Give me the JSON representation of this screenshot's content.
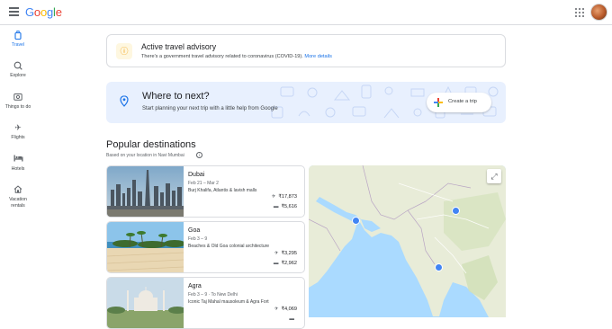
{
  "header": {
    "logo": [
      "G",
      "o",
      "o",
      "g",
      "l",
      "e"
    ],
    "menu_icon": "hamburger-menu-icon",
    "apps_icon": "apps-grid-icon"
  },
  "nav": [
    {
      "label": "Travel",
      "icon": "suitcase-icon",
      "active": true
    },
    {
      "label": "Explore",
      "icon": "explore-icon",
      "active": false
    },
    {
      "label": "Things to do",
      "icon": "camera-icon",
      "active": false
    },
    {
      "label": "Flights",
      "icon": "flight-icon",
      "active": false
    },
    {
      "label": "Hotels",
      "icon": "hotel-icon",
      "active": false
    },
    {
      "label": "Vacation rentals",
      "icon": "house-icon",
      "active": false
    }
  ],
  "advisory": {
    "title": "Active travel advisory",
    "text": "There's a government travel advisory related to coronavirus (COVID-19).",
    "link": "More details"
  },
  "where": {
    "title": "Where to next?",
    "subtitle": "Start planning your next trip with a little help from Google",
    "button": "Create a trip"
  },
  "popular": {
    "title": "Popular destinations",
    "subtitle": "Based on your location in Navi Mumbai",
    "destinations": [
      {
        "name": "Dubai",
        "dates": "Feb 21 – Mar 2",
        "desc": "Burj Khalifa, Atlantis & lavish malls",
        "flight_price": "₹17,873",
        "hotel_price": "₹5,616"
      },
      {
        "name": "Goa",
        "dates": "Feb 3 – 9",
        "desc": "Beaches & Old Goa colonial architecture",
        "flight_price": "₹3,295",
        "hotel_price": "₹2,962"
      },
      {
        "name": "Agra",
        "dates": "Feb 3 – 9 · To New Delhi",
        "desc": "Iconic Taj Mahal mausoleum & Agra Fort",
        "flight_price": "₹4,069",
        "hotel_price": ""
      }
    ]
  },
  "colors": {
    "accent": "#1a73e8",
    "advisory_bg": "#fef7e0",
    "advisory_icon": "#f29900",
    "where_bg": "#e8f0fe",
    "map_water": "#aadaff",
    "map_land": "#e8ecd8"
  }
}
